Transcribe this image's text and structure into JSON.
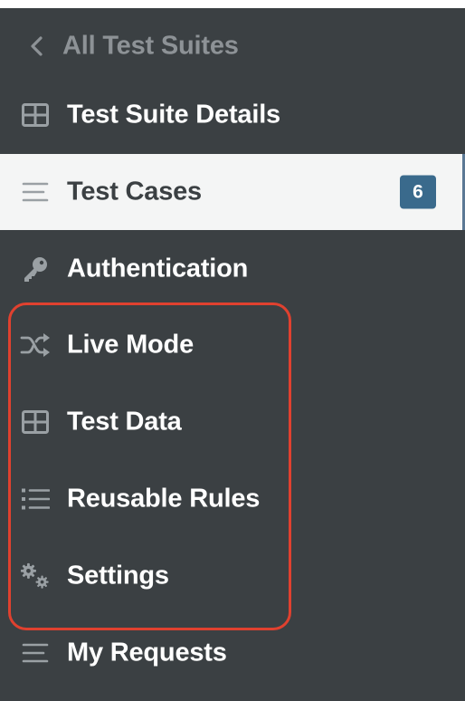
{
  "sidebar": {
    "back": {
      "label": "All Test Suites",
      "icon": "chevron-left-icon"
    },
    "items": [
      {
        "label": "Test Suite Details",
        "icon": "table-grid-icon",
        "active": false
      },
      {
        "label": "Test Cases",
        "icon": "lines-icon",
        "active": true,
        "badge": "6"
      },
      {
        "label": "Authentication",
        "icon": "key-icon",
        "active": false
      },
      {
        "label": "Live Mode",
        "icon": "shuffle-icon",
        "active": false
      },
      {
        "label": "Test Data",
        "icon": "table-grid-icon",
        "active": false
      },
      {
        "label": "Reusable Rules",
        "icon": "list-icon",
        "active": false
      },
      {
        "label": "Settings",
        "icon": "gears-icon",
        "active": false
      },
      {
        "label": "My Requests",
        "icon": "lines-icon",
        "active": false
      }
    ]
  },
  "colors": {
    "sidebar_bg": "#3b4043",
    "active_bg": "#f4f5f5",
    "badge_bg": "#3a6a8c",
    "highlight_border": "#e0412f",
    "muted_text": "#8d9296"
  }
}
